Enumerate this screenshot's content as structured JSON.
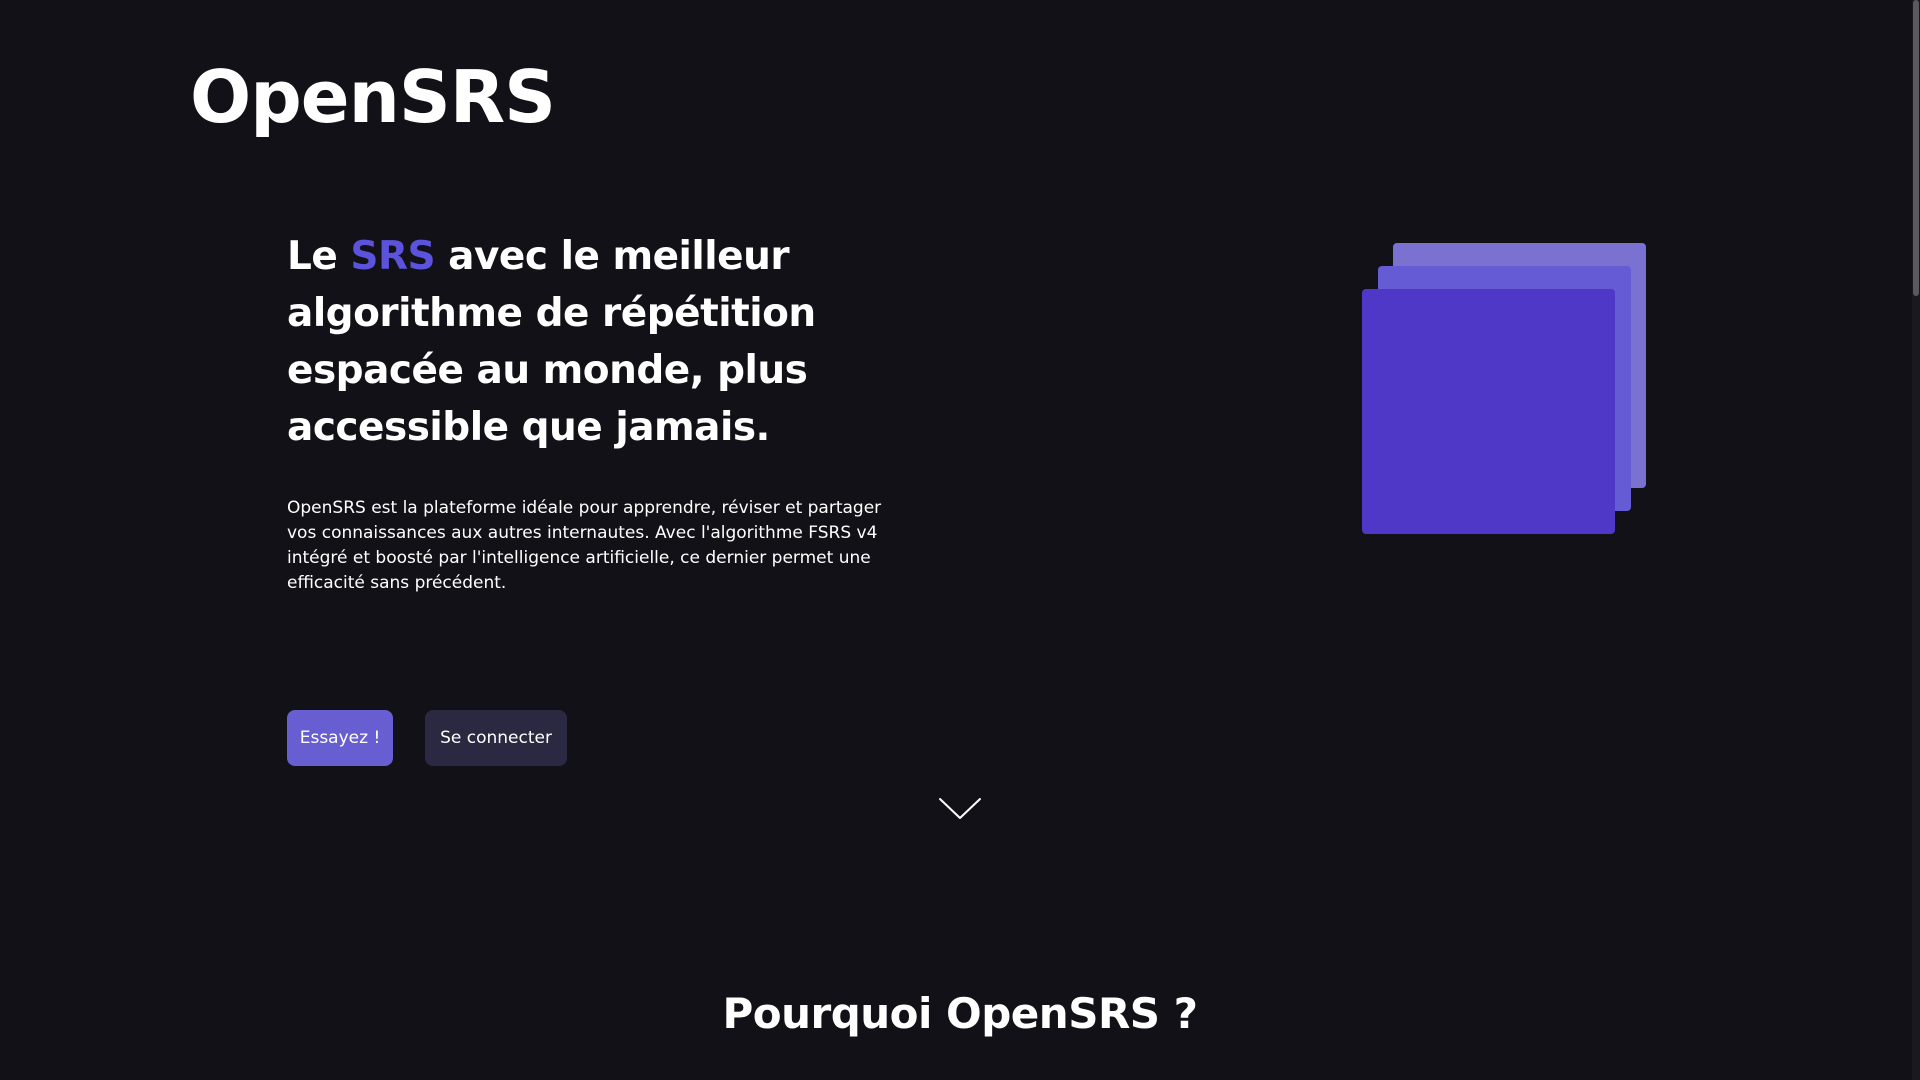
{
  "header": {
    "logo_text": "OpenSRS"
  },
  "hero": {
    "title_prefix": "Le ",
    "title_accent": "SRS",
    "title_suffix": " avec le meilleur algorithme de répétition espacée au monde, plus accessible que jamais.",
    "description": "OpenSRS est la plateforme idéale pour apprendre, réviser et partager vos connaissances aux autres internautes. Avec l'algorithme FSRS v4 intégré et boosté par l'intelligence artificielle, ce dernier permet une efficacité sans précédent.",
    "primary_button": "Essayez !",
    "secondary_button": "Se connecter",
    "scroll_icon": "chevron-down-icon"
  },
  "illustration": {
    "name": "card-stack",
    "colors": [
      "#7a71d1",
      "#645bd5",
      "#4f37c8"
    ]
  },
  "section": {
    "title": "Pourquoi OpenSRS ?"
  },
  "colors": {
    "background": "#121118",
    "accent": "#5b53dc",
    "primary_button": "#675ed1",
    "secondary_button": "#2b2942"
  }
}
